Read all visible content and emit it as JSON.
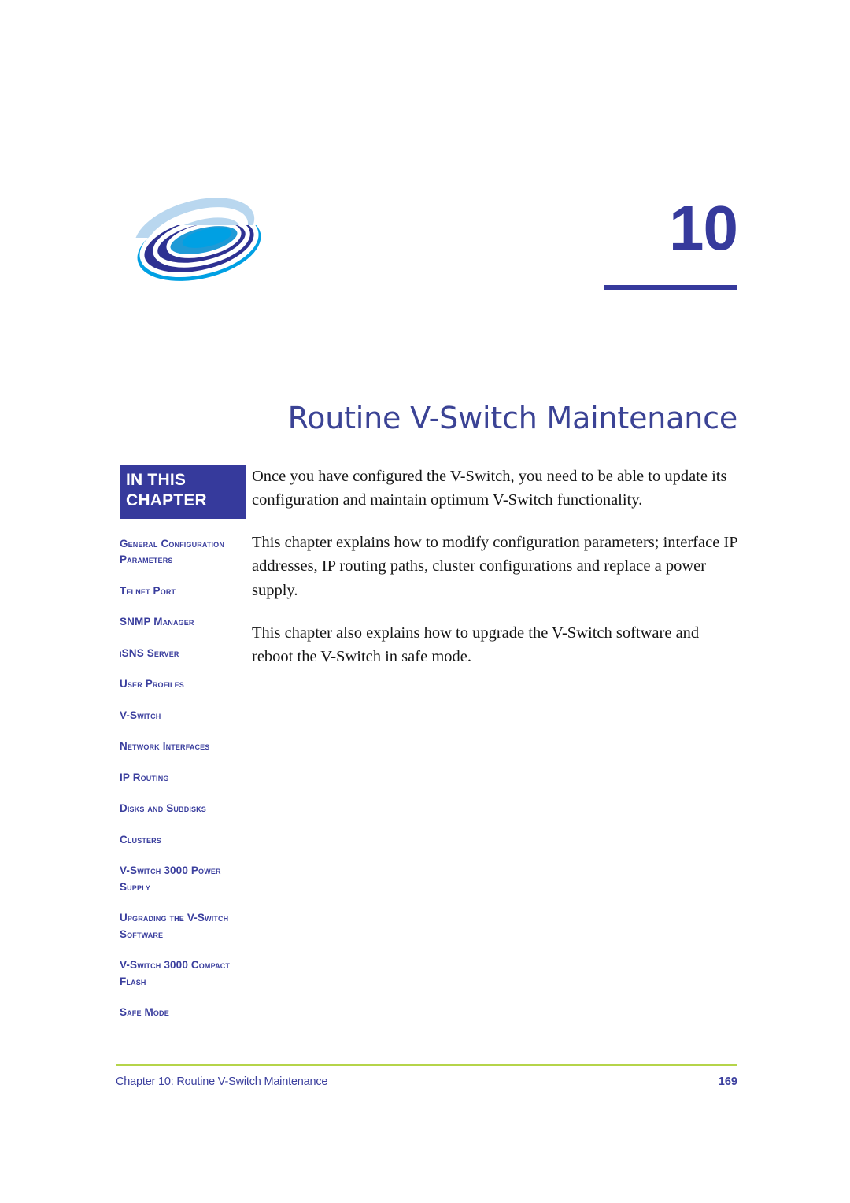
{
  "colors": {
    "navy": "#363a9c",
    "title_blue": "#3b4395",
    "toc_blue": "#3b3f9e",
    "footer_rule_green": "#b5d44a",
    "logo_light_blue": "#b9d7ef",
    "logo_cyan": "#00a0e3",
    "logo_navy": "#2e3192",
    "body_text": "#161616"
  },
  "header": {
    "chapter_number": "10",
    "logo_name": "swirl-globe-logo"
  },
  "title": "Routine V-Switch Maintenance",
  "sidebar": {
    "heading_line1": "IN THIS",
    "heading_line2": "CHAPTER",
    "items": [
      {
        "label": "General Configuration Parameters"
      },
      {
        "label": "Telnet Port"
      },
      {
        "label": "SNMP Manager"
      },
      {
        "label": "iSNS Server"
      },
      {
        "label": "User Profiles"
      },
      {
        "label": "V-Switch"
      },
      {
        "label": "Network Interfaces"
      },
      {
        "label": "IP Routing"
      },
      {
        "label": "Disks and Subdisks"
      },
      {
        "label": "Clusters"
      },
      {
        "label": "V-Switch 3000 Power Supply"
      },
      {
        "label": "Upgrading the V-Switch Software"
      },
      {
        "label": "V-Switch 3000 Compact Flash"
      },
      {
        "label": "Safe Mode"
      }
    ]
  },
  "body": {
    "paragraphs": [
      "Once you have configured the V-Switch, you need to be able to update its configuration and maintain optimum V-Switch functionality.",
      "This chapter explains how to modify configuration parameters; interface IP addresses, IP routing paths, cluster configurations and replace a power supply.",
      "This chapter also explains how to upgrade the V-Switch software and reboot the V-Switch in safe mode."
    ]
  },
  "footer": {
    "left": "Chapter 10:  Routine V-Switch Maintenance",
    "page_number": "169"
  }
}
